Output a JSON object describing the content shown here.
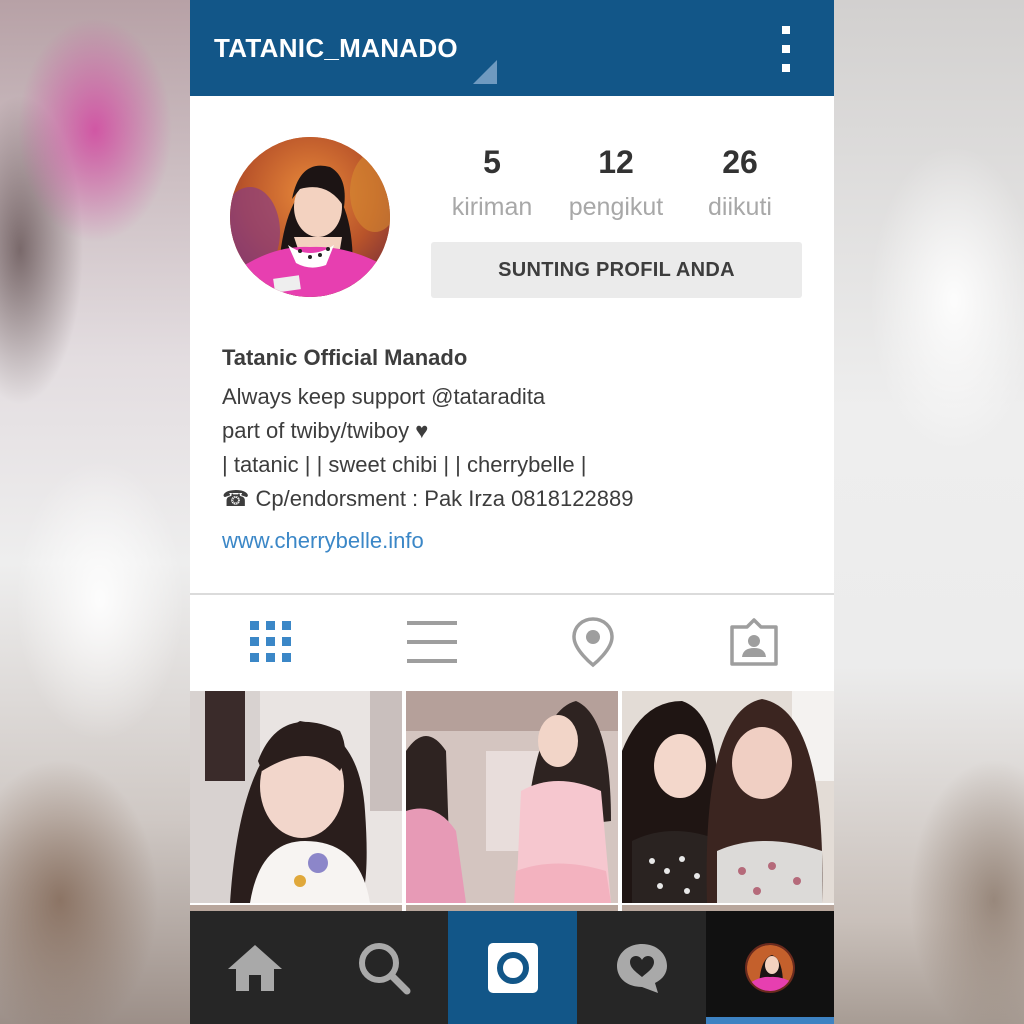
{
  "app": {
    "username": "TATANIC_MANADO"
  },
  "stats": [
    {
      "value": "5",
      "label": "kiriman"
    },
    {
      "value": "12",
      "label": "pengikut"
    },
    {
      "value": "26",
      "label": "diikuti"
    }
  ],
  "edit_button": "SUNTING PROFIL ANDA",
  "bio": {
    "name": "Tatanic Official Manado",
    "lines": [
      "Always keep support @tataradita",
      "part of twiby/twiboy ♥",
      "| tatanic | | sweet chibi | | cherrybelle |",
      "☎ Cp/endorsment : Pak Irza 0818122889"
    ],
    "website": "www.cherrybelle.info"
  },
  "view_tabs": [
    {
      "icon": "grid-icon",
      "active": true
    },
    {
      "icon": "list-icon",
      "active": false
    },
    {
      "icon": "location-pin-icon",
      "active": false
    },
    {
      "icon": "tagged-photos-icon",
      "active": false
    }
  ],
  "bottom_nav": [
    {
      "icon": "home-icon"
    },
    {
      "icon": "search-icon"
    },
    {
      "icon": "camera-icon",
      "highlighted": true
    },
    {
      "icon": "activity-heart-icon"
    },
    {
      "icon": "profile-avatar",
      "active": true
    }
  ],
  "colors": {
    "topbar": "#125688",
    "active_tab": "#3b87c7",
    "inactive_icon": "#a8a8a8",
    "link": "#3b87c7",
    "bottom_bar": "#262626"
  }
}
